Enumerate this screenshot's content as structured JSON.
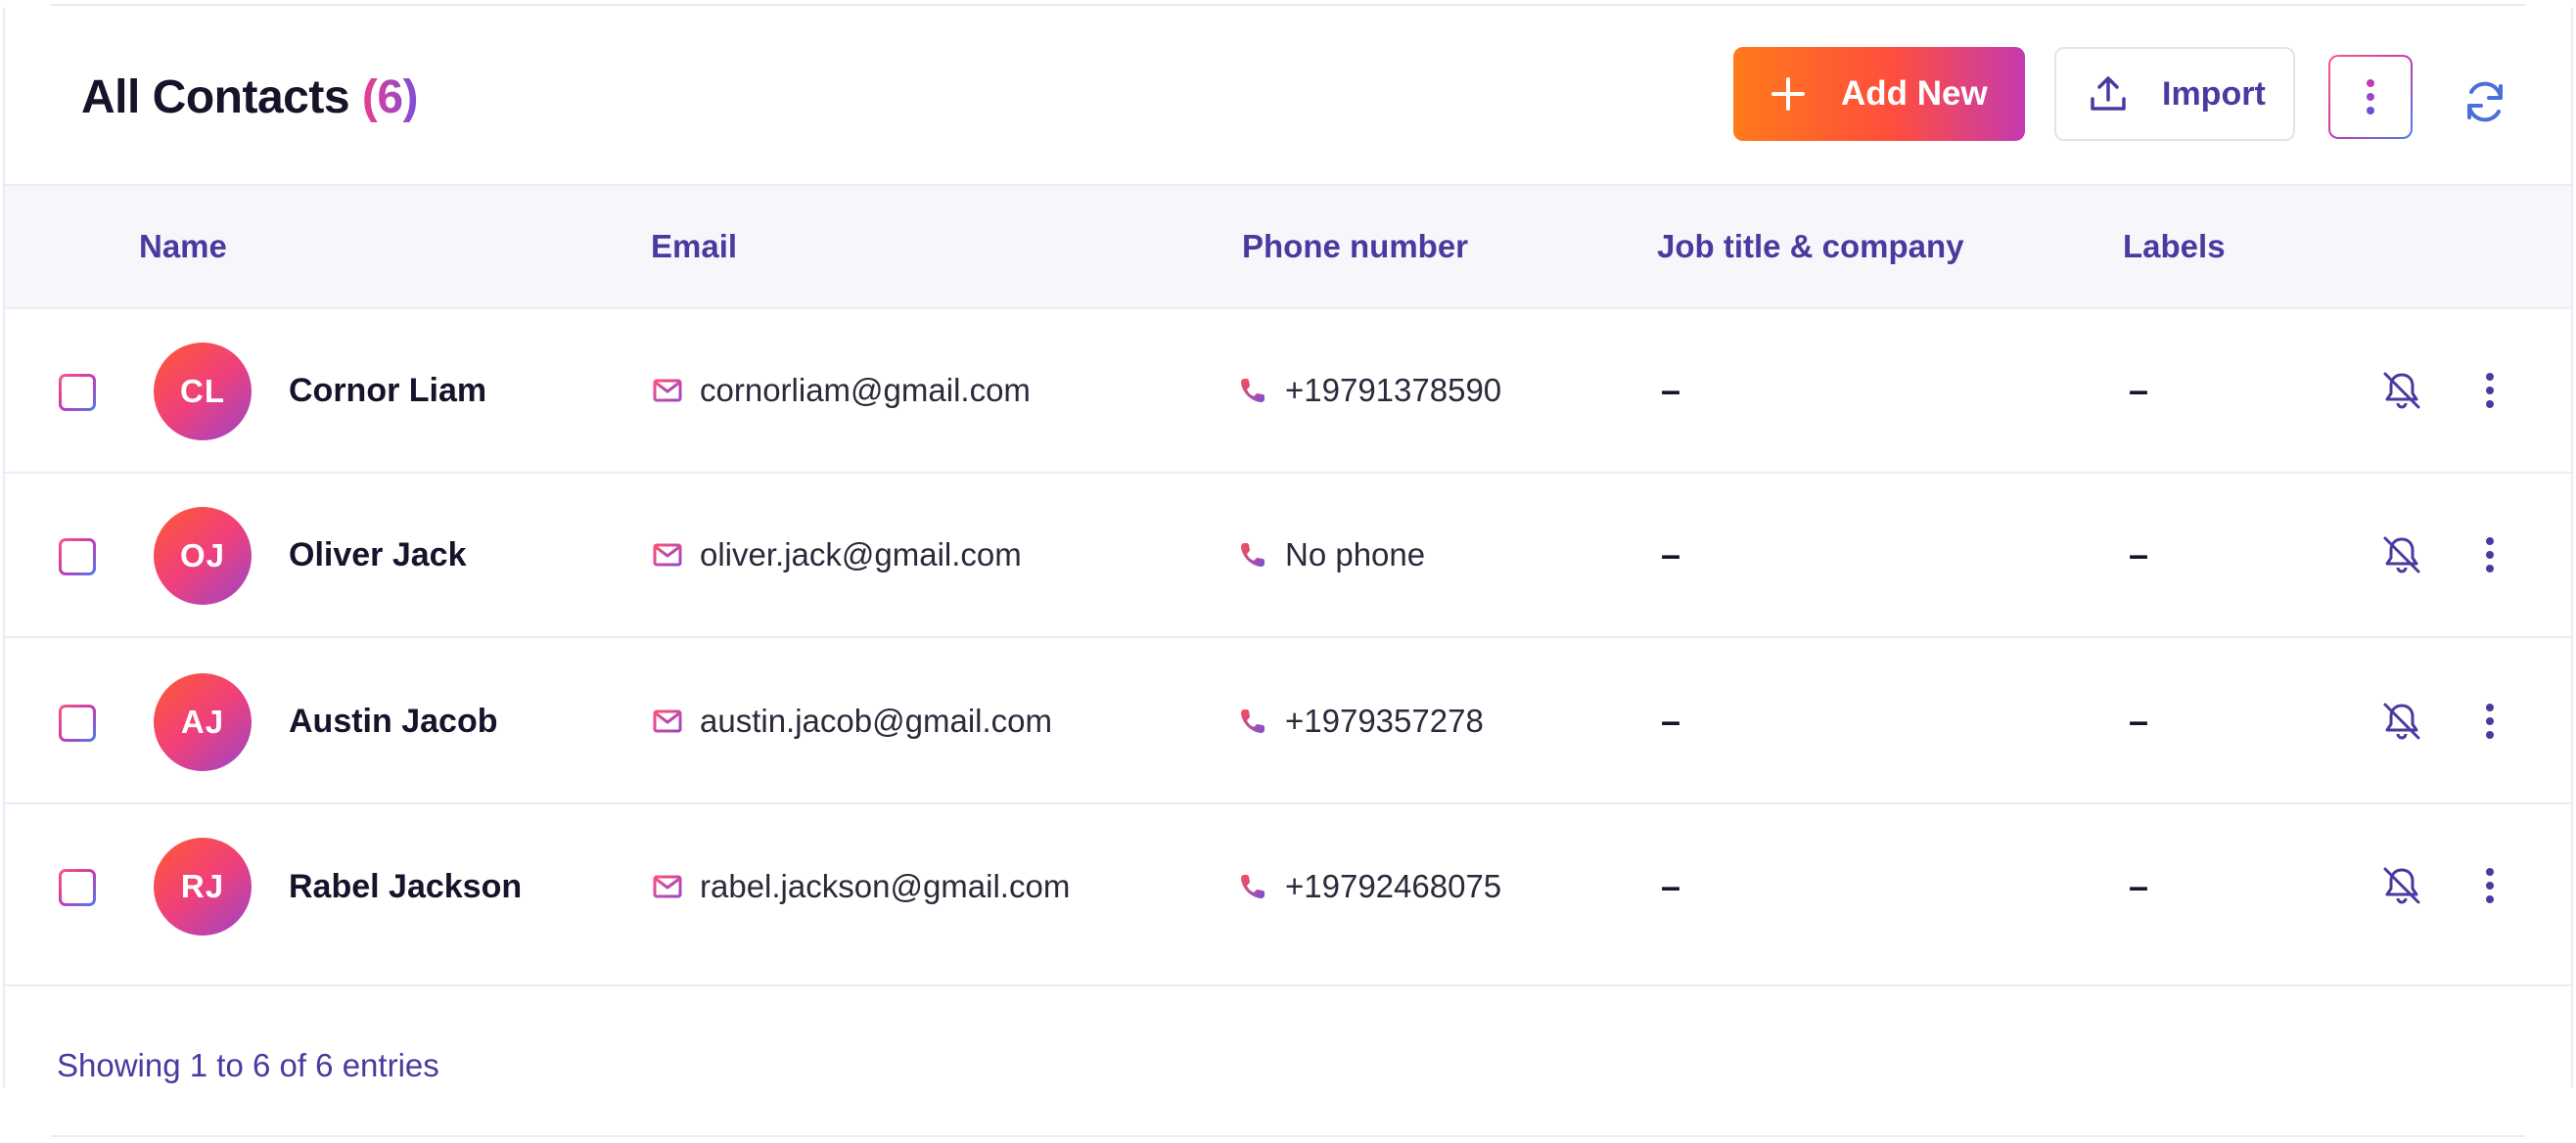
{
  "header": {
    "title": "All Contacts",
    "count": "(6)",
    "add_new_label": "Add New",
    "import_label": "Import"
  },
  "table": {
    "columns": [
      "Name",
      "Email",
      "Phone number",
      "Job title & company",
      "Labels"
    ],
    "rows": [
      {
        "initials": "CL",
        "name": "Cornor Liam",
        "email": "cornorliam@gmail.com",
        "phone": "+19791378590",
        "job": "–",
        "labels": "–"
      },
      {
        "initials": "OJ",
        "name": "Oliver Jack",
        "email": "oliver.jack@gmail.com",
        "phone": "No phone",
        "job": "–",
        "labels": "–"
      },
      {
        "initials": "AJ",
        "name": "Austin Jacob",
        "email": "austin.jacob@gmail.com",
        "phone": "+1979357278",
        "job": "–",
        "labels": "–"
      },
      {
        "initials": "RJ",
        "name": "Rabel Jackson",
        "email": "rabel.jackson@gmail.com",
        "phone": "+19792468075",
        "job": "–",
        "labels": "–"
      }
    ]
  },
  "footer": {
    "entries_text": "Showing 1 to 6 of 6 entries"
  },
  "colors": {
    "accent_text": "#4a3aa0",
    "gradient_start": "#ff7a1a",
    "gradient_end": "#c43ab0"
  },
  "icons": [
    "plus-icon",
    "upload-icon",
    "kebab-icon",
    "refresh-icon",
    "mail-icon",
    "phone-icon",
    "bell-off-icon"
  ]
}
